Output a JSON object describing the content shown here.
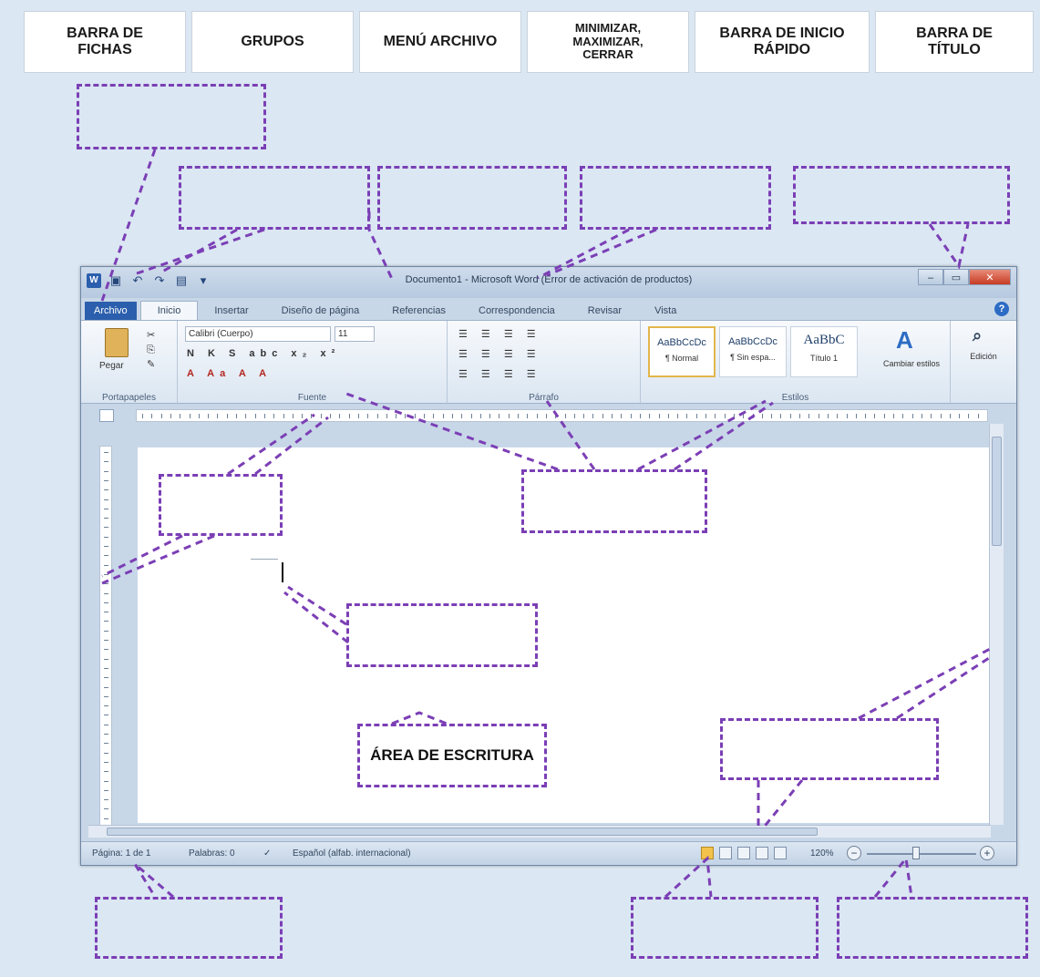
{
  "labels": [
    {
      "text": "BARRA DE\nFICHAS"
    },
    {
      "text": "GRUPOS"
    },
    {
      "text": "MENÚ ARCHIVO"
    },
    {
      "text": "MINIMIZAR,\nMAXIMIZAR,\nCERRAR"
    },
    {
      "text": "BARRA DE INICIO\nRÁPIDO"
    },
    {
      "text": "BARRA DE\nTÍTULO"
    }
  ],
  "writing_area_label": "ÁREA DE ESCRITURA",
  "window": {
    "title": "Documento1 - Microsoft Word (Error de activación de productos)",
    "word_logo": "W"
  },
  "tabs": [
    "Archivo",
    "Inicio",
    "Insertar",
    "Diseño de página",
    "Referencias",
    "Correspondencia",
    "Revisar",
    "Vista"
  ],
  "ribbon": {
    "paste": "Pegar",
    "groups": [
      "Portapapeles",
      "Fuente",
      "Párrafo",
      "Estilos",
      "Edición"
    ],
    "font_name": "Calibri (Cuerpo)",
    "font_size": "11",
    "font_row1": "N K S abc x₂ x²",
    "font_row2": "A Aa A A",
    "para_row1": "☰ ☰ ☰ ☰",
    "styles": [
      {
        "sample": "AaBbCcDc",
        "name": "¶ Normal"
      },
      {
        "sample": "AaBbCcDc",
        "name": "¶ Sin espa..."
      },
      {
        "sample": "AaBbC",
        "name": "Título 1"
      }
    ],
    "change_styles": "Cambiar estilos",
    "editing": "Edición"
  },
  "status": {
    "page": "Página: 1 de 1",
    "words": "Palabras: 0",
    "language": "Español (alfab. internacional)",
    "zoom": "120%"
  }
}
